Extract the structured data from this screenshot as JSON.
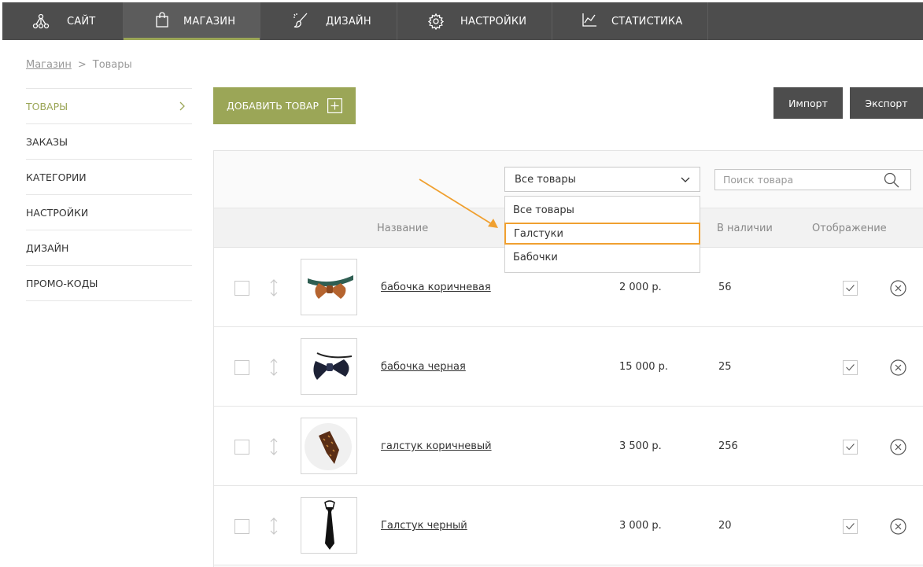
{
  "nav": {
    "items": [
      {
        "label": "САЙТ",
        "icon": "network-icon"
      },
      {
        "label": "МАГАЗИН",
        "icon": "shopping-bag-icon"
      },
      {
        "label": "ДИЗАЙН",
        "icon": "brush-icon"
      },
      {
        "label": "НАСТРОЙКИ",
        "icon": "gear-icon"
      },
      {
        "label": "СТАТИСТИКА",
        "icon": "line-chart-icon"
      }
    ],
    "active": "МАГАЗИН"
  },
  "breadcrumb": {
    "root": "Магазин",
    "separator": ">",
    "current": "Товары"
  },
  "sidebar": {
    "items": [
      "ТОВАРЫ",
      "ЗАКАЗЫ",
      "КАТЕГОРИИ",
      "НАСТРОЙКИ",
      "ДИЗАЙН",
      "ПРОМО-КОДЫ"
    ],
    "active": "ТОВАРЫ"
  },
  "toolbar": {
    "add_label": "ДОБАВИТЬ ТОВАР",
    "import_label": "Импорт",
    "export_label": "Экспорт"
  },
  "filter": {
    "selected": "Все товары",
    "options": [
      "Все товары",
      "Галстуки",
      "Бабочки"
    ],
    "highlighted": "Галстуки"
  },
  "search": {
    "placeholder": "Поиск товара"
  },
  "columns": {
    "name": "Название",
    "stock": "В наличии",
    "display": "Отображение"
  },
  "products": [
    {
      "name": "бабочка коричневая",
      "price": "2 000 р.",
      "stock": "56",
      "visible": true
    },
    {
      "name": "бабочка черная",
      "price": "15 000 р.",
      "stock": "25",
      "visible": true
    },
    {
      "name": "галстук коричневый",
      "price": "3 500 р.",
      "stock": "256",
      "visible": true
    },
    {
      "name": "Галстук черный",
      "price": "3 000 р.",
      "stock": "20",
      "visible": true
    }
  ],
  "colors": {
    "accent": "#9ba657",
    "nav_bg": "#4d4d4d",
    "highlight": "#f0a030"
  }
}
